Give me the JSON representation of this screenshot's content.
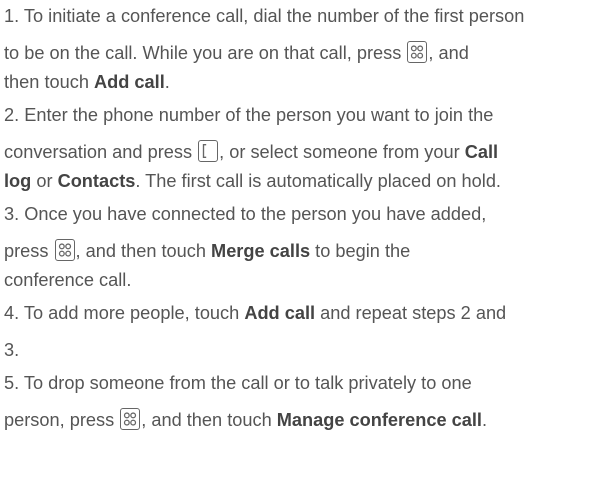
{
  "steps": [
    {
      "lines": [
        [
          {
            "t": "text",
            "v": "1. To initiate a conference call, dial the number of the first person"
          }
        ],
        [
          {
            "t": "text",
            "v": "to be on the call. While you are on that call, press "
          },
          {
            "t": "icon",
            "v": "menu-icon"
          },
          {
            "t": "text",
            "v": ", and"
          }
        ],
        [
          {
            "t": "text",
            "v": "then touch "
          },
          {
            "t": "bold",
            "v": "Add call"
          },
          {
            "t": "text",
            "v": "."
          }
        ]
      ]
    },
    {
      "lines": [
        [
          {
            "t": "text",
            "v": "2. Enter the phone number of the person you want to join the"
          }
        ],
        [
          {
            "t": "text",
            "v": "conversation and press "
          },
          {
            "t": "icon",
            "v": "call-icon"
          },
          {
            "t": "text",
            "v": ", or select someone from your "
          },
          {
            "t": "bold",
            "v": "Call"
          }
        ],
        [
          {
            "t": "bold",
            "v": "log"
          },
          {
            "t": "text",
            "v": " or "
          },
          {
            "t": "bold",
            "v": "Contacts"
          },
          {
            "t": "text",
            "v": ". The first call is automatically placed on hold."
          }
        ]
      ]
    },
    {
      "lines": [
        [
          {
            "t": "text",
            "v": "3. Once you have connected to the person you have added,"
          }
        ],
        [
          {
            "t": "text",
            "v": "press "
          },
          {
            "t": "icon",
            "v": "menu-icon"
          },
          {
            "t": "text",
            "v": ", and then touch "
          },
          {
            "t": "bold",
            "v": "Merge calls"
          },
          {
            "t": "text",
            "v": " to begin the"
          }
        ],
        [
          {
            "t": "text",
            "v": "conference call."
          }
        ]
      ]
    },
    {
      "lines": [
        [
          {
            "t": "text",
            "v": "4. To add more people, touch "
          },
          {
            "t": "bold",
            "v": "Add call"
          },
          {
            "t": "text",
            "v": " and repeat steps 2 and"
          }
        ],
        [
          {
            "t": "text",
            "v": "3."
          }
        ]
      ]
    },
    {
      "lines": [
        [
          {
            "t": "text",
            "v": "5. To drop someone from the call or to talk privately to one"
          }
        ],
        [
          {
            "t": "text",
            "v": "person, press "
          },
          {
            "t": "icon",
            "v": "menu-icon"
          },
          {
            "t": "text",
            "v": ", and then touch "
          },
          {
            "t": "bold",
            "v": "Manage conference call"
          },
          {
            "t": "text",
            "v": "."
          }
        ]
      ]
    }
  ]
}
